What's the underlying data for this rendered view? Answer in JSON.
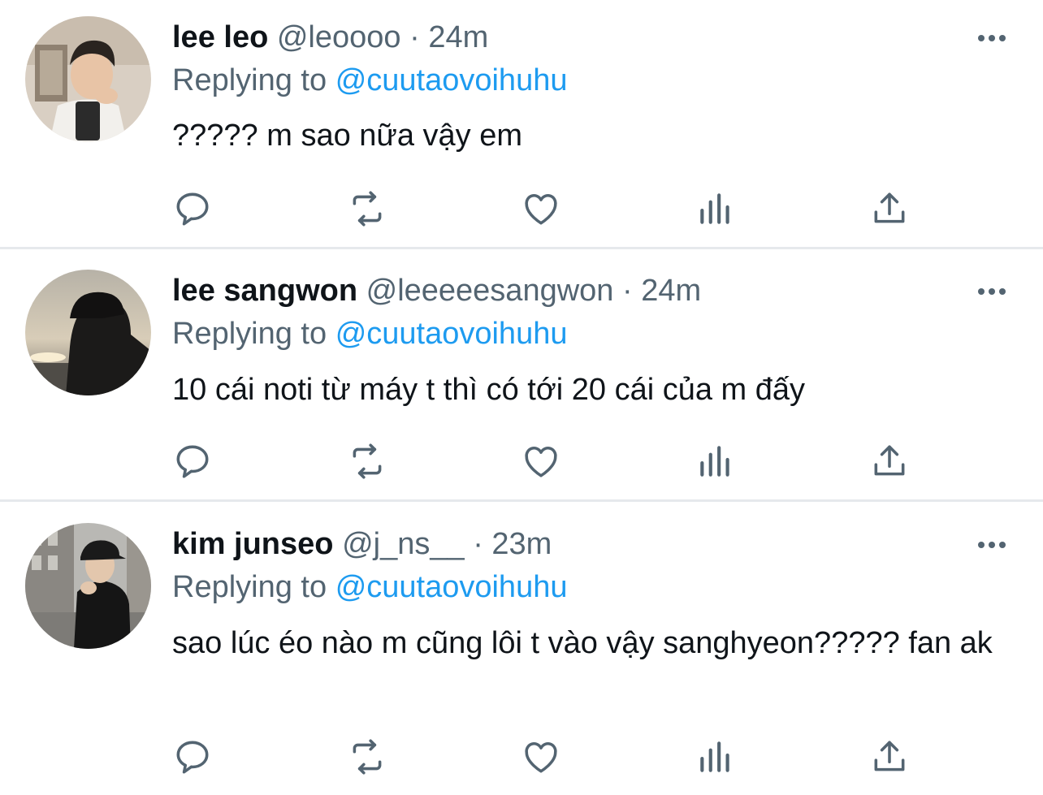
{
  "reply_prefix": "Replying to",
  "more_icon": "more-horizontal-icon",
  "actions": [
    "reply-icon",
    "retweet-icon",
    "like-icon",
    "analytics-icon",
    "share-icon"
  ],
  "colors": {
    "text": "#0f1419",
    "secondary": "#536471",
    "link": "#1d9bf0",
    "divider": "#e6e9ec"
  },
  "tweets": [
    {
      "name": "lee leo",
      "handle": "@leoooo",
      "separator": "·",
      "time": "24m",
      "reply_to": "@cuutaovoihuhu",
      "text": "????? m sao nữa vậy em"
    },
    {
      "name": "lee sangwon",
      "handle": "@leeeeesangwon",
      "separator": "·",
      "time": "24m",
      "reply_to": "@cuutaovoihuhu",
      "text": "10 cái noti từ máy t thì có tới 20 cái của m đấy"
    },
    {
      "name": "kim junseo",
      "handle": "@j_ns__",
      "separator": "·",
      "time": "23m",
      "reply_to": "@cuutaovoihuhu",
      "text": "sao lúc éo nào m cũng lôi t vào vậy sanghyeon????? fan ak"
    }
  ]
}
